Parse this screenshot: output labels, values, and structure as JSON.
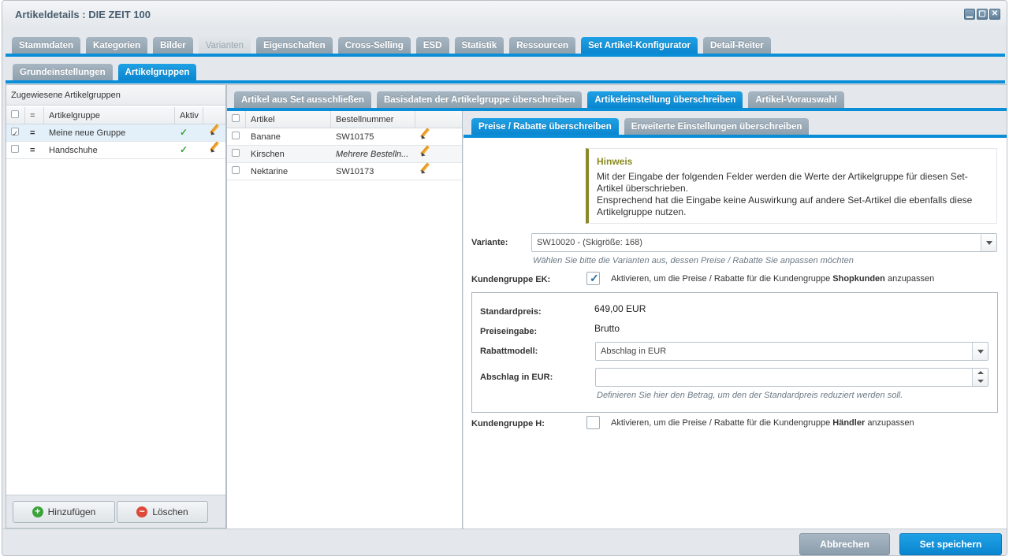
{
  "window": {
    "title": "Artikeldetails : DIE ZEIT 100",
    "buttons": [
      "▁",
      "▢",
      "✕"
    ]
  },
  "main_tabs": [
    "Stammdaten",
    "Kategorien",
    "Bilder",
    "Varianten",
    "Eigenschaften",
    "Cross-Selling",
    "ESD",
    "Statistik",
    "Ressourcen",
    "Set Artikel-Konfigurator",
    "Detail-Reiter"
  ],
  "sub_tabs": [
    "Grundeinstellungen",
    "Artikelgruppen"
  ],
  "left_panel": {
    "title": "Zugewiesene Artikelgruppen",
    "columns": [
      "=",
      "Artikelgruppe",
      "Aktiv"
    ],
    "rows": [
      {
        "name": "Meine neue Gruppe"
      },
      {
        "name": "Handschuhe"
      }
    ],
    "add_label": "Hinzufügen",
    "delete_label": "Löschen"
  },
  "group_tabs": [
    "Artikel aus Set ausschließen",
    "Basisdaten der Artikelgruppe überschreiben",
    "Artikeleinstellung überschreiben",
    "Artikel-Vorauswahl"
  ],
  "articles": {
    "columns": [
      "Artikel",
      "Bestellnummer"
    ],
    "rows": [
      {
        "name": "Banane",
        "number": "SW10175"
      },
      {
        "name": "Kirschen",
        "number": "Mehrere Bestelln..."
      },
      {
        "name": "Nektarine",
        "number": "SW10173"
      }
    ]
  },
  "override_tabs": [
    "Preise / Rabatte überschreiben",
    "Erweiterte Einstellungen überschreiben"
  ],
  "notice": {
    "title": "Hinweis",
    "text": "Mit der Eingabe der folgenden Felder werden die Werte der Artikelgruppe für diesen Set-Artikel überschrieben.",
    "text2": "Ensprechend hat die Eingabe keine Auswirkung auf andere Set-Artikel die ebenfalls diese Artikelgruppe nutzen."
  },
  "form": {
    "variant_label": "Variante:",
    "variant_value": "SW10020 - (Skigröße: 168)",
    "variant_hint": "Wählen Sie bitte die Varianten aus, dessen Preise / Rabatte Sie anpassen möchten",
    "ek_label": "Kundengruppe EK:",
    "ek_text_pre": "Aktivieren, um die Preise / Rabatte für die Kundengruppe",
    "ek_group": "Shopkunden",
    "ek_text_post": "anzupassen",
    "std_price_label": "Standardpreis:",
    "std_price_value": "649,00 EUR",
    "price_input_label": "Preiseingabe:",
    "price_input_value": "Brutto",
    "discount_model_label": "Rabattmodell:",
    "discount_model_value": "Abschlag in EUR",
    "discount_label": "Abschlag in EUR:",
    "discount_value": "",
    "discount_hint": "Definieren Sie hier den Betrag, um den der Standardpreis reduziert werden soll.",
    "h_label": "Kundengruppe H:",
    "h_text_pre": "Aktivieren, um die Preise / Rabatte für die Kundengruppe",
    "h_group": "Händler",
    "h_text_post": "anzupassen"
  },
  "footer": {
    "cancel_label": "Abbrechen",
    "save_label": "Set speichern"
  },
  "colors": {
    "accent": "#0b8ed8",
    "notice_bar": "#8a8a2a",
    "notice_title": "#8a8a22"
  }
}
